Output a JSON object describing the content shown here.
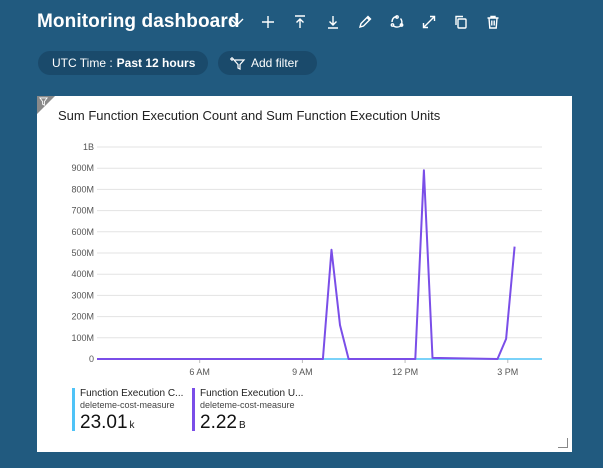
{
  "header": {
    "title": "Monitoring dashboard",
    "icons": [
      "chevron-down-icon",
      "plus-icon",
      "move-to-top-icon",
      "move-to-bottom-icon",
      "edit-icon",
      "share-icon",
      "expand-icon",
      "copy-icon",
      "delete-icon"
    ]
  },
  "filters": {
    "time_label": "UTC Time :",
    "time_value": "Past 12 hours",
    "add_filter": "Add filter"
  },
  "tile": {
    "title": "Sum Function Execution Count and Sum Function Execution Units",
    "legend": [
      {
        "name": "Function Execution C...",
        "resource": "deleteme-cost-measure",
        "value": "23.01",
        "unit": "k",
        "color": "#4fc3f7"
      },
      {
        "name": "Function Execution U...",
        "resource": "deleteme-cost-measure",
        "value": "2.22",
        "unit": "B",
        "color": "#7a4ee8"
      }
    ]
  },
  "chart_data": {
    "type": "line",
    "y_ticks": [
      "0",
      "100M",
      "200M",
      "300M",
      "400M",
      "500M",
      "600M",
      "700M",
      "800M",
      "900M",
      "1B"
    ],
    "x_ticks": [
      "6 AM",
      "9 AM",
      "12 PM",
      "3 PM"
    ],
    "ylim": [
      0,
      1000000000
    ],
    "x_hours_domain": [
      3,
      16
    ],
    "series": [
      {
        "name": "Function Execution C...",
        "color": "#4fc3f7",
        "points": [
          [
            3,
            0
          ],
          [
            16,
            0
          ]
        ]
      },
      {
        "name": "Function Execution U...",
        "color": "#7a4ee8",
        "points": [
          [
            3,
            0
          ],
          [
            9.6,
            0
          ],
          [
            9.85,
            515000000
          ],
          [
            10.1,
            160000000
          ],
          [
            10.35,
            0
          ],
          [
            12.3,
            0
          ],
          [
            12.55,
            890000000
          ],
          [
            12.8,
            5000000
          ],
          [
            14.7,
            0
          ],
          [
            14.95,
            95000000
          ],
          [
            15.2,
            530000000
          ]
        ]
      }
    ]
  }
}
